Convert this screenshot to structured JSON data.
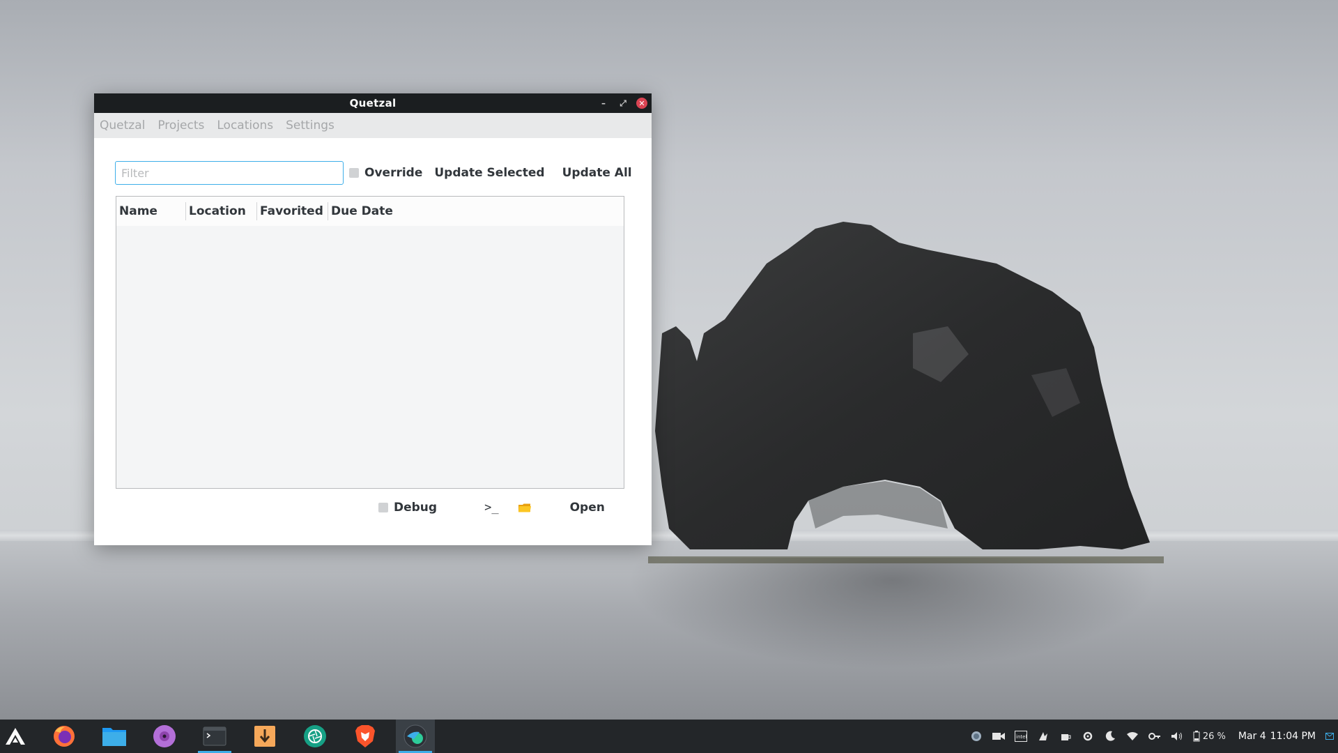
{
  "window": {
    "title": "Quetzal",
    "controls": {
      "minimize": "–",
      "maximize": "⤢",
      "close": "✕"
    }
  },
  "menu": {
    "items": [
      "Quetzal",
      "Projects",
      "Locations",
      "Settings"
    ]
  },
  "toolbar": {
    "filter_placeholder": "Filter",
    "filter_value": "",
    "override_label": "Override",
    "update_selected_label": "Update Selected",
    "update_all_label": "Update All"
  },
  "table": {
    "columns": [
      "Name",
      "Location",
      "Favorited",
      "Due Date"
    ],
    "rows": []
  },
  "bottom": {
    "debug_label": "Debug",
    "terminal_label": ">_",
    "open_label": "Open"
  },
  "taskbar": {
    "apps": [
      {
        "icon": "app-launcher-icon"
      },
      {
        "icon": "firefox-icon"
      },
      {
        "icon": "file-manager-icon"
      },
      {
        "icon": "music-player-icon"
      },
      {
        "icon": "terminal-icon"
      },
      {
        "icon": "download-manager-icon"
      },
      {
        "icon": "camera-app-icon"
      },
      {
        "icon": "brave-browser-icon"
      },
      {
        "icon": "quetzal-icon"
      }
    ],
    "tray": {
      "battery_percent": "26 %",
      "date": "Mar 4",
      "time": "11:04 PM"
    }
  },
  "colors": {
    "accent": "#3daee9",
    "titlebar": "#1b1e20",
    "close": "#da4453",
    "taskbar": "#232629"
  }
}
